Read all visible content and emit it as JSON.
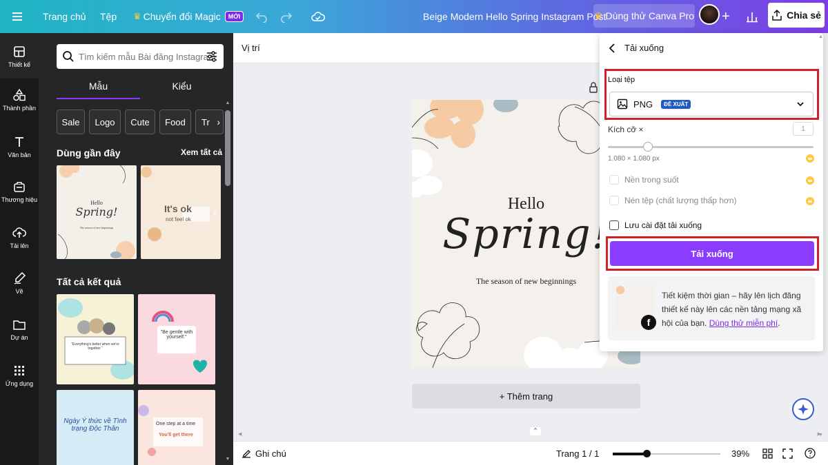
{
  "topbar": {
    "home": "Trang chủ",
    "file": "Tệp",
    "magic_switch": "Chuyển đổi Magic",
    "new_badge": "MỚI",
    "doc_title": "Beige Modern Hello Spring Instagram Post",
    "try_pro": "Dùng thử Canva Pro",
    "share": "Chia sẻ"
  },
  "rail": {
    "items": [
      {
        "label": "Thiết kế",
        "icon": "layout-icon"
      },
      {
        "label": "Thành phần",
        "icon": "shapes-icon"
      },
      {
        "label": "Văn bản",
        "icon": "text-icon"
      },
      {
        "label": "Thương hiệu",
        "icon": "brand-icon"
      },
      {
        "label": "Tải lên",
        "icon": "upload-icon"
      },
      {
        "label": "Vẽ",
        "icon": "draw-icon"
      },
      {
        "label": "Dự án",
        "icon": "folder-icon"
      },
      {
        "label": "Ứng dụng",
        "icon": "apps-icon"
      }
    ]
  },
  "panel": {
    "search_placeholder": "Tìm kiếm mẫu Bài đăng Instagram",
    "tab_templates": "Mẫu",
    "tab_styles": "Kiểu",
    "chips": [
      "Sale",
      "Logo",
      "Cute",
      "Food",
      "Tr"
    ],
    "recent_title": "Dùng gần đây",
    "see_all": "Xem tất cả",
    "all_results_title": "Tất cả kết quả",
    "thumbs": {
      "recent1_line1": "Hello",
      "recent1_line2": "Spring!",
      "recent1_line3": "The season of new beginnings",
      "recent2_line1": "It's ok",
      "recent2_line2": "not feel ok",
      "result1_text": "\"Everything's better when we're together.\"",
      "result2_text": "\"Be gentle with yourself.\"",
      "result3_text": "Ngày Ý thức về Tình trạng Độc Thân",
      "result4_line1": "One step at a time",
      "result4_line2": "You'll get there"
    }
  },
  "editor": {
    "position_label": "Vị trí",
    "canvas_hello": "Hello",
    "canvas_spring": "Spring!",
    "canvas_subtitle": "The season of new beginnings",
    "add_page": "+ Thêm trang"
  },
  "download": {
    "title": "Tải xuống",
    "file_type_label": "Loại tệp",
    "file_type_value": "PNG",
    "recommended_badge": "ĐỀ XUẤT",
    "size_label": "Kích cỡ ×",
    "size_value": "1",
    "size_multiplier": 1,
    "dimensions": "1.080 × 1.080 px",
    "transparent_bg": "Nền trong suốt",
    "compress_file": "Nén tệp (chất lượng thấp hơn)",
    "save_settings": "Lưu cài đặt tải xuống",
    "download_button": "Tải xuống",
    "promo_text": "Tiết kiệm thời gian – hãy lên lịch đăng thiết kế này lên các nền tảng mạng xã hội của bạn.",
    "promo_link": "Dùng thử miễn phí",
    "promo_period": "."
  },
  "statusbar": {
    "notes": "Ghi chú",
    "page_indicator": "Trang 1 / 1",
    "zoom": "39%",
    "zoom_level": 0.39
  },
  "colors": {
    "brand_purple": "#8b3dff",
    "highlight_red": "#d0202c",
    "recommended_blue": "#1e59c4",
    "sidebar_dark": "#18191b"
  }
}
